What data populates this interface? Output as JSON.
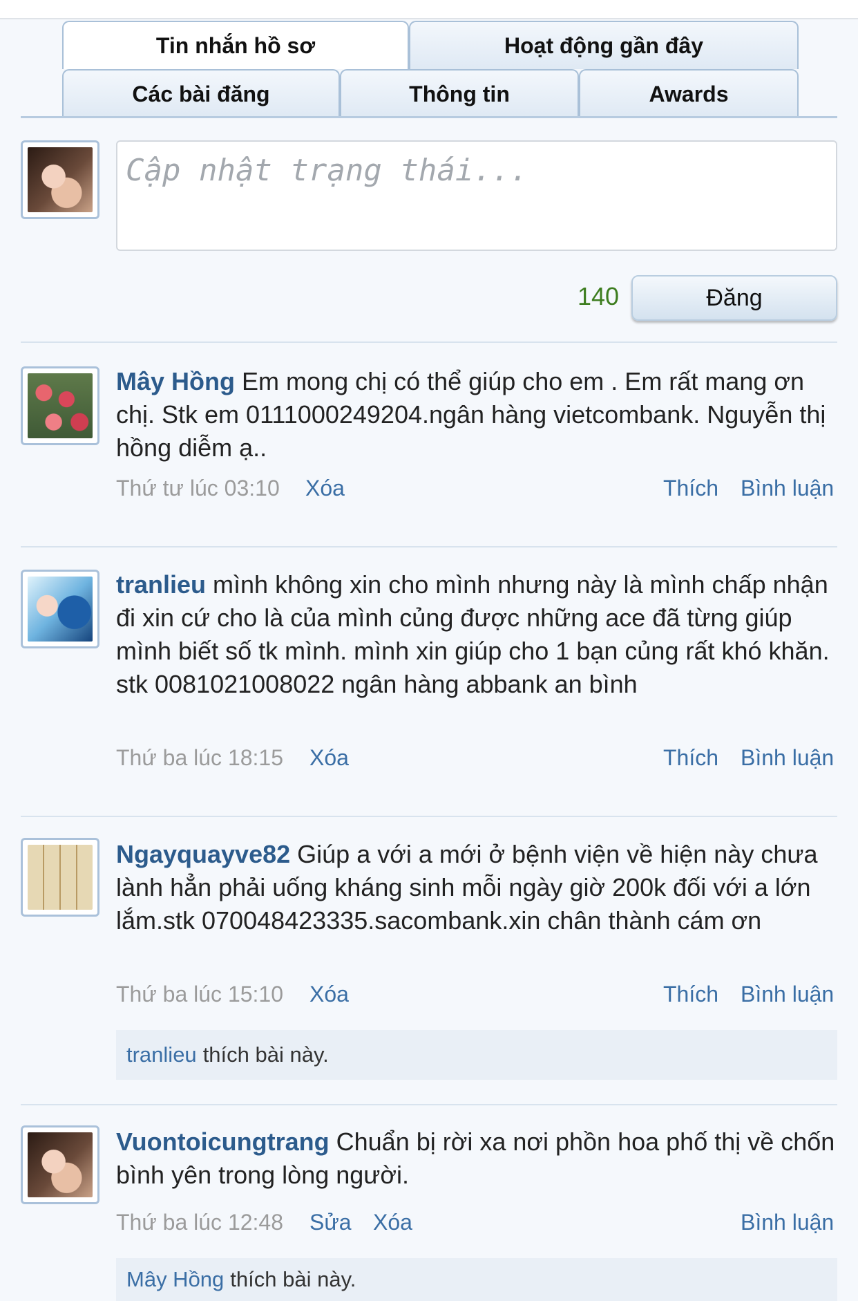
{
  "tabs": {
    "profile_messages": "Tin nhắn hồ sơ",
    "recent_activity": "Hoạt động gần đây",
    "posts": "Các bài đăng",
    "info": "Thông tin",
    "awards": "Awards"
  },
  "status": {
    "placeholder": "Cập nhật trạng thái...",
    "char_counter": "140",
    "post_button": "Đăng"
  },
  "posts": [
    {
      "author": "Mây Hồng",
      "avatar": "flowers-avatar",
      "text": "Em mong chị có thể giúp cho em . Em rất mang ơn chị. Stk em 0111000249204.ngân hàng vietcombank. Nguyễn thị hồng diễm ạ..",
      "time": "Thứ tư lúc 03:10",
      "delete": "Xóa",
      "like": "Thích",
      "comment": "Bình luận"
    },
    {
      "author": "tranlieu",
      "avatar": "ocean-avatar",
      "text": "mình không xin cho mình nhưng này là mình chấp nhận đi xin cứ cho là của mình củng được những ace đã từng giúp mình biết số tk mình. mình xin giúp cho 1 bạn củng rất khó khăn. stk 0081021008022 ngân hàng abbank an bình",
      "time": "Thứ ba lúc 18:15",
      "delete": "Xóa",
      "like": "Thích",
      "comment": "Bình luận"
    },
    {
      "author": "Ngayquayve82",
      "avatar": "calendar-avatar",
      "text": "Giúp a với a mới ở bệnh viện về hiện này chưa lành hẳn phải uống kháng sinh mỗi ngày giờ 200k đối với a lớn lắm.stk 070048423335.sacombank.xin chân thành cám ơn",
      "time": "Thứ ba lúc 15:10",
      "delete": "Xóa",
      "like": "Thích",
      "comment": "Bình luận",
      "liked_by": "tranlieu",
      "liked_suffix": "thích bài này."
    },
    {
      "author": "Vuontoicungtrang",
      "avatar": "girl-avatar",
      "text": "Chuẩn bị rời xa nơi phồn hoa phố thị về chốn bình yên trong lòng người.",
      "time": "Thứ ba lúc 12:48",
      "edit": "Sửa",
      "delete": "Xóa",
      "comment": "Bình luận",
      "liked_by": "Mây Hồng",
      "liked_suffix": "thích bài này."
    }
  ],
  "colors": {
    "link": "#3a6ea5",
    "username": "#2c5b8c",
    "counter": "#3d7d1f",
    "meta": "#9b9b9b",
    "tab_border": "#a9c0d8"
  }
}
